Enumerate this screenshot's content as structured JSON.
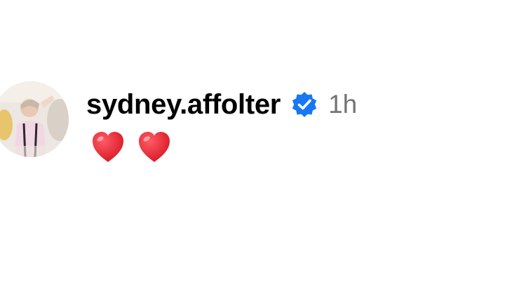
{
  "comment": {
    "username": "sydney.affolter",
    "verified": true,
    "verified_icon": "verified-badge-icon",
    "timestamp": "1h",
    "text_emojis": [
      "heart-emoji",
      "heart-emoji"
    ],
    "colors": {
      "username": "#000000",
      "timestamp": "#737373",
      "verified_badge": "#1877F2",
      "heart": "#E0202F"
    }
  }
}
